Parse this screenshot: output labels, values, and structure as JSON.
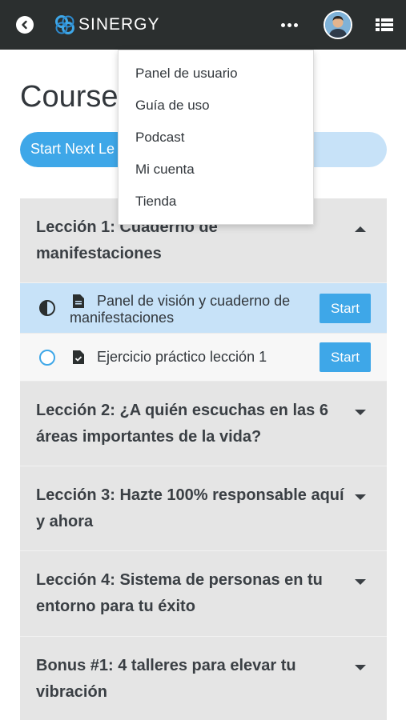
{
  "header": {
    "logo_text": "SINERGY",
    "back_icon": "back-arrow-circle-icon",
    "more_icon": "ellipsis-icon",
    "menu_icon": "list-icon",
    "background": "#2b2f2f"
  },
  "dropdown": {
    "items": [
      {
        "label": "Panel de usuario"
      },
      {
        "label": "Guía de uso"
      },
      {
        "label": "Podcast"
      },
      {
        "label": "Mi cuenta"
      },
      {
        "label": "Tienda"
      }
    ]
  },
  "page": {
    "title": "Course",
    "start_next_label": "Start Next Le",
    "accent": "#3ea7e8"
  },
  "lessons": [
    {
      "title": "Lección 1: Cuaderno de manifestaciones",
      "expanded": true,
      "topics": [
        {
          "title": "Panel de visión y cuaderno de manifestaciones",
          "status": "in-progress",
          "button": "Start"
        },
        {
          "title": "Ejercicio práctico lección 1",
          "status": "not-started",
          "button": "Start"
        }
      ]
    },
    {
      "title": "Lección 2: ¿A quién escuchas en las 6 áreas importantes de la vida?",
      "expanded": false
    },
    {
      "title": "Lección 3: Hazte 100% responsable aquí y ahora",
      "expanded": false
    },
    {
      "title": "Lección 4: Sistema de personas en tu entorno para tu éxito",
      "expanded": false
    },
    {
      "title": "Bonus #1: 4 talleres para elevar tu vibración",
      "expanded": false
    }
  ]
}
